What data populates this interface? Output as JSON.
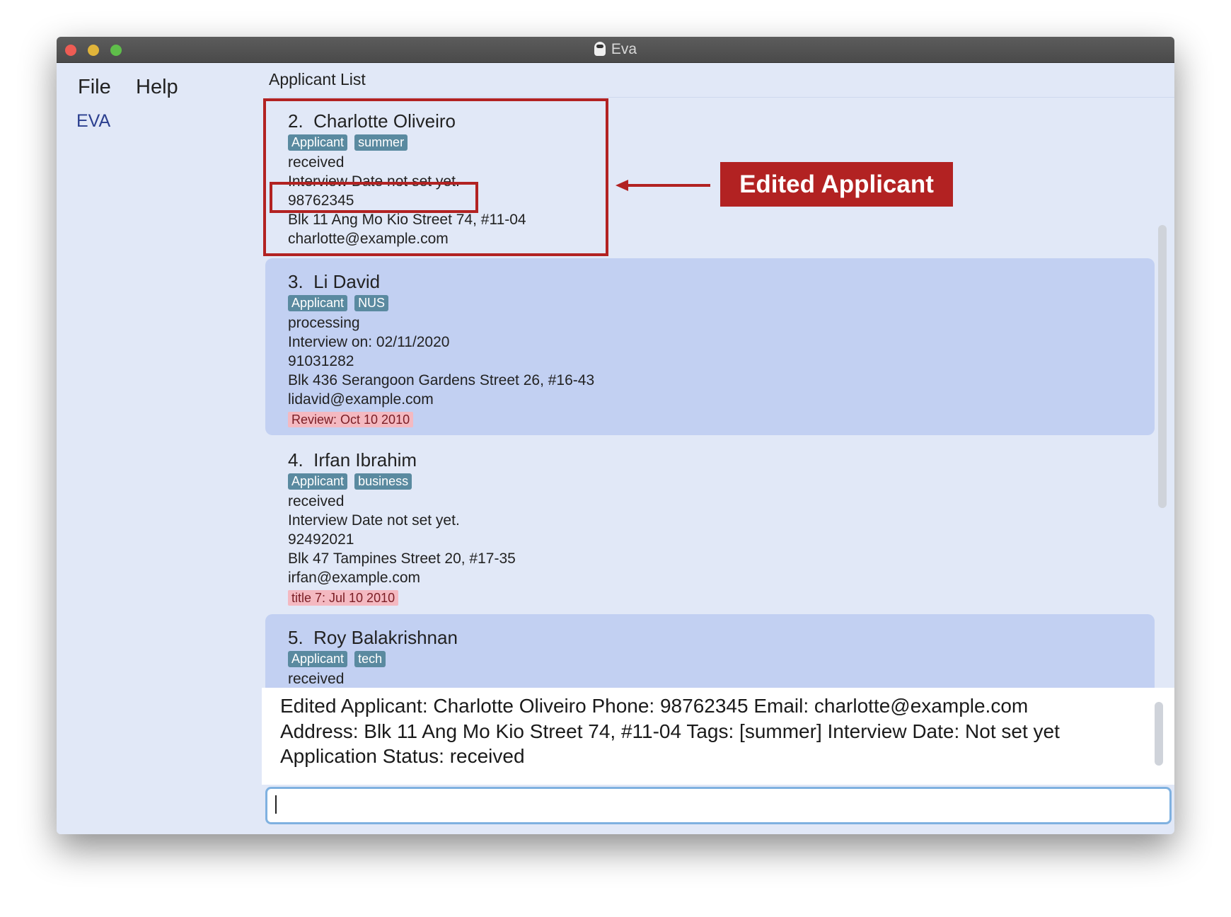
{
  "window": {
    "title": "Eva",
    "colors": {
      "close": "#ee5c54",
      "minimize": "#e0b43a",
      "zoom": "#5fbe4a"
    }
  },
  "menu": {
    "file": "File",
    "help": "Help"
  },
  "sidebar": {
    "brand": "EVA"
  },
  "list": {
    "header": "Applicant List",
    "items": [
      {
        "index": "2.",
        "name": "Charlotte Oliveiro",
        "tags": [
          "Applicant",
          "summer"
        ],
        "status": "received",
        "interview": "Interview Date not set yet.",
        "phone": "98762345",
        "address": "Blk 11 Ang Mo Kio Street 74, #11-04",
        "email": "charlotte@example.com"
      },
      {
        "index": "3.",
        "name": "Li David",
        "tags": [
          "Applicant",
          "NUS"
        ],
        "status": "processing",
        "interview": "Interview on: 02/11/2020",
        "phone": "91031282",
        "address": "Blk 436 Serangoon Gardens Street 26, #16-43",
        "email": "lidavid@example.com",
        "comment": "Review: Oct 10 2010"
      },
      {
        "index": "4.",
        "name": "Irfan Ibrahim",
        "tags": [
          "Applicant",
          "business"
        ],
        "status": "received",
        "interview": "Interview Date not set yet.",
        "phone": "92492021",
        "address": "Blk 47 Tampines Street 20, #17-35",
        "email": "irfan@example.com",
        "comment": "title 7: Jul 10 2010"
      },
      {
        "index": "5.",
        "name": "Roy Balakrishnan",
        "tags": [
          "Applicant",
          "tech"
        ],
        "status": "received"
      }
    ]
  },
  "result": {
    "lines": [
      "Edited Applicant: Charlotte Oliveiro Phone: 98762345 Email: charlotte@example.com",
      "Address: Blk 11 Ang Mo Kio Street 74, #11-04 Tags: [summer] Interview Date: Not set yet",
      "Application Status: received"
    ]
  },
  "command": {
    "value": ""
  },
  "annotation": {
    "label": "Edited Applicant",
    "color": "#b22222"
  }
}
